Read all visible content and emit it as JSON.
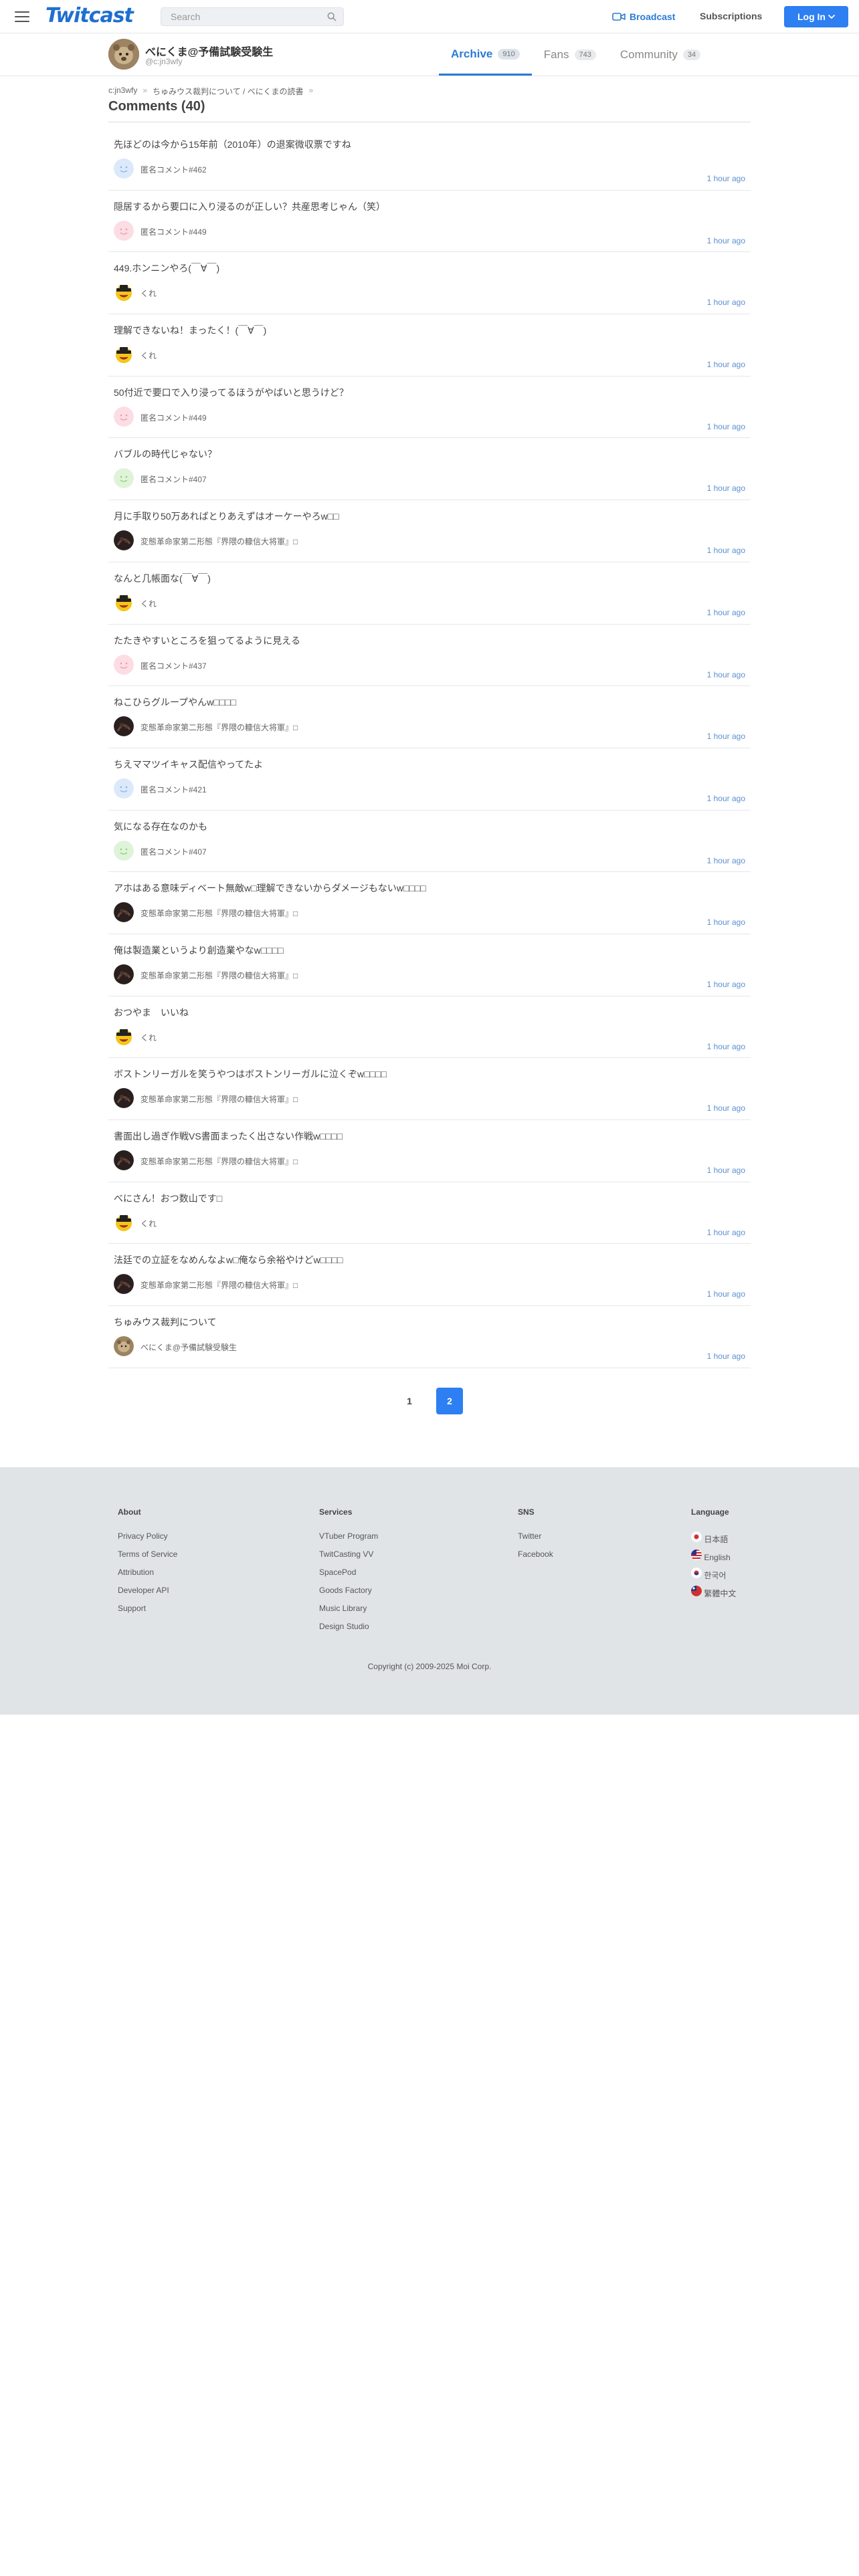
{
  "header": {
    "logo": "Twitcast",
    "search_placeholder": "Search",
    "broadcast_label": "Broadcast",
    "subscriptions_label": "Subscriptions",
    "login_label": "Log In"
  },
  "profile": {
    "name": "べにくま@予備試験受験生",
    "id": "@c:jn3wfy",
    "tabs": [
      {
        "label": "Archive",
        "count": "910"
      },
      {
        "label": "Fans",
        "count": "743"
      },
      {
        "label": "Community",
        "count": "34"
      }
    ]
  },
  "breadcrumb": {
    "items": [
      "c:jn3wfy",
      "ちゅみウス裁判について / べにくまの読書"
    ],
    "sep": "»"
  },
  "page_title": "Comments (40)",
  "comments": [
    {
      "text": "先ほどのは今から15年前（2010年）の退案微収票ですね",
      "user": "匿名コメント#462",
      "avatar": "blue",
      "time": "1 hour ago"
    },
    {
      "text": "隠居するから要口に入り浸るのが正しい？共産思考じゃん（笑）",
      "user": "匿名コメント#449",
      "avatar": "pink",
      "time": "1 hour ago"
    },
    {
      "text": "449.ホンニンやろ(￣∀￣)",
      "user": "くれ",
      "avatar": "smiley",
      "time": "1 hour ago"
    },
    {
      "text": "理解できないね！まったく！(￣∀￣)",
      "user": "くれ",
      "avatar": "smiley",
      "time": "1 hour ago"
    },
    {
      "text": "50付近で要口で入り浸ってるほうがやばいと思うけど？",
      "user": "匿名コメント#449",
      "avatar": "pink",
      "time": "1 hour ago"
    },
    {
      "text": "バブルの時代じゃない？",
      "user": "匿名コメント#407",
      "avatar": "green",
      "time": "1 hour ago"
    },
    {
      "text": "月に手取り50万あればとりあえずはオーケーやろw□□",
      "user": "変態革命家第二形態『界隈の糠信大将軍』□",
      "avatar": "dark",
      "time": "1 hour ago"
    },
    {
      "text": "なんと几帳面な(￣∀￣)",
      "user": "くれ",
      "avatar": "smiley",
      "time": "1 hour ago"
    },
    {
      "text": "たたきやすいところを狙ってるように見える",
      "user": "匿名コメント#437",
      "avatar": "pink",
      "time": "1 hour ago"
    },
    {
      "text": "ねこひらグループやんw□□□□",
      "user": "変態革命家第二形態『界隈の糠信大将軍』□",
      "avatar": "dark",
      "time": "1 hour ago"
    },
    {
      "text": "ちえママツイキャス配信やってたよ",
      "user": "匿名コメント#421",
      "avatar": "blue",
      "time": "1 hour ago"
    },
    {
      "text": "気になる存在なのかも",
      "user": "匿名コメント#407",
      "avatar": "green",
      "time": "1 hour ago"
    },
    {
      "text": "アホはある意味ディベート無敵w□理解できないからダメージもないw□□□□",
      "user": "変態革命家第二形態『界隈の糠信大将軍』□",
      "avatar": "dark",
      "time": "1 hour ago"
    },
    {
      "text": "俺は製造業というより創造業やなw□□□□",
      "user": "変態革命家第二形態『界隈の糠信大将軍』□",
      "avatar": "dark",
      "time": "1 hour ago"
    },
    {
      "text": "おつやま　いいね",
      "user": "くれ",
      "avatar": "smiley",
      "time": "1 hour ago"
    },
    {
      "text": "ボストンリーガルを笑うやつはボストンリーガルに泣くぞw□□□□",
      "user": "変態革命家第二形態『界隈の糠信大将軍』□",
      "avatar": "dark",
      "time": "1 hour ago"
    },
    {
      "text": "書面出し過ぎ作戦VS書面まったく出さない作戦w□□□□",
      "user": "変態革命家第二形態『界隈の糠信大将軍』□",
      "avatar": "dark",
      "time": "1 hour ago"
    },
    {
      "text": "べにさん！おつ数山です□",
      "user": "くれ",
      "avatar": "smiley",
      "time": "1 hour ago"
    },
    {
      "text": "法廷での立証をなめんなよw□俺なら余裕やけどw□□□□",
      "user": "変態革命家第二形態『界隈の糠信大将軍』□",
      "avatar": "dark",
      "time": "1 hour ago"
    },
    {
      "text": "ちゅみウス裁判について",
      "user": "べにくま@予備試験受験生",
      "avatar": "owner",
      "time": "1 hour ago"
    }
  ],
  "pagination": {
    "pages": [
      "1",
      "2"
    ],
    "current": "2"
  },
  "footer": {
    "about": {
      "title": "About",
      "links": [
        "Privacy Policy",
        "Terms of Service",
        "Attribution",
        "Developer API",
        "Support"
      ]
    },
    "services": {
      "title": "Services",
      "links": [
        "VTuber Program",
        "TwitCasting VV",
        "SpacePod",
        "Goods Factory",
        "Music Library",
        "Design Studio"
      ]
    },
    "sns": {
      "title": "SNS",
      "links": [
        "Twitter",
        "Facebook"
      ]
    },
    "language": {
      "title": "Language",
      "links": [
        "日本語",
        "English",
        "한국어",
        "繁體中文"
      ]
    },
    "copyright": "Copyright (c) 2009-2025 Moi Corp."
  },
  "colors": {
    "accent": "#2d7ff2",
    "link": "#2b7bd6",
    "footer_bg": "#e1e4e7"
  }
}
